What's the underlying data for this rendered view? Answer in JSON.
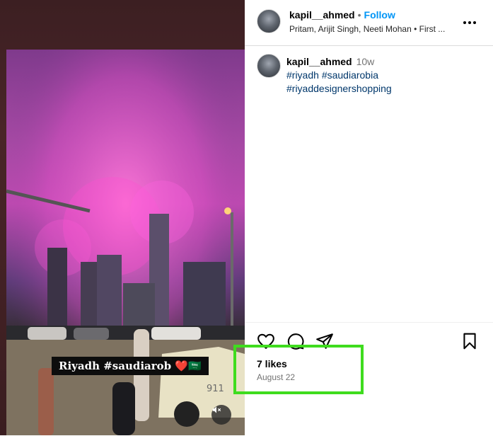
{
  "post": {
    "username": "kapil__ahmed",
    "follow_label": "Follow",
    "separator": "•",
    "audio": "Pritam, Arijit Singh, Neeti Mohan • First ...",
    "caption": {
      "username": "kapil__ahmed",
      "time_ago": "10w",
      "hashtags": [
        "#riyadh",
        "#saudiarobia",
        "#riyaddesignershopping"
      ]
    },
    "likes": "7 likes",
    "date": "August 22"
  },
  "video": {
    "overlay_text": "Riyadh #saudiarob ❤️🇸🇦",
    "taxi_number": "911"
  },
  "icons": {
    "more": "more-options-icon",
    "like": "heart-icon",
    "comment": "comment-icon",
    "share": "share-icon",
    "save": "bookmark-icon",
    "mute": "muted-speaker-icon"
  },
  "colors": {
    "follow": "#0095f6",
    "hashtag": "#00376b",
    "highlight": "#3fdc1e",
    "fireworks": "#e04fc8"
  }
}
